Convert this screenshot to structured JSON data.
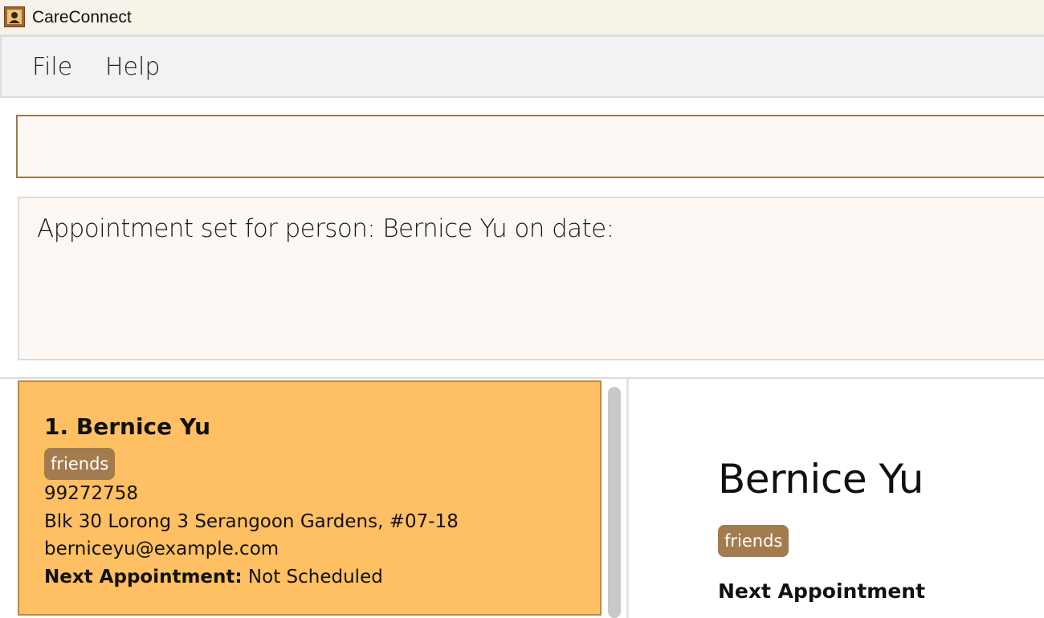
{
  "window": {
    "title": "CareConnect",
    "icon": "contact-book-icon"
  },
  "menu": {
    "items": [
      "File",
      "Help"
    ]
  },
  "command": {
    "value": "",
    "placeholder": ""
  },
  "result": {
    "message": "Appointment set for person: Bernice Yu on date:"
  },
  "person_list": [
    {
      "index_name": "1. Bernice Yu",
      "tags": [
        "friends"
      ],
      "phone": "99272758",
      "address": "Blk 30 Lorong 3 Serangoon Gardens, #07-18",
      "email": "berniceyu@example.com",
      "appointment_label": "Next Appointment:",
      "appointment_value": "Not Scheduled"
    }
  ],
  "detail": {
    "name": "Bernice Yu",
    "tags": [
      "friends"
    ],
    "appointment_heading": "Next Appointment"
  },
  "colors": {
    "selected_card": "#ffbf63",
    "tag_background": "#a27c4f",
    "command_border": "#a17847",
    "panel_background": "#fdf8f3"
  }
}
